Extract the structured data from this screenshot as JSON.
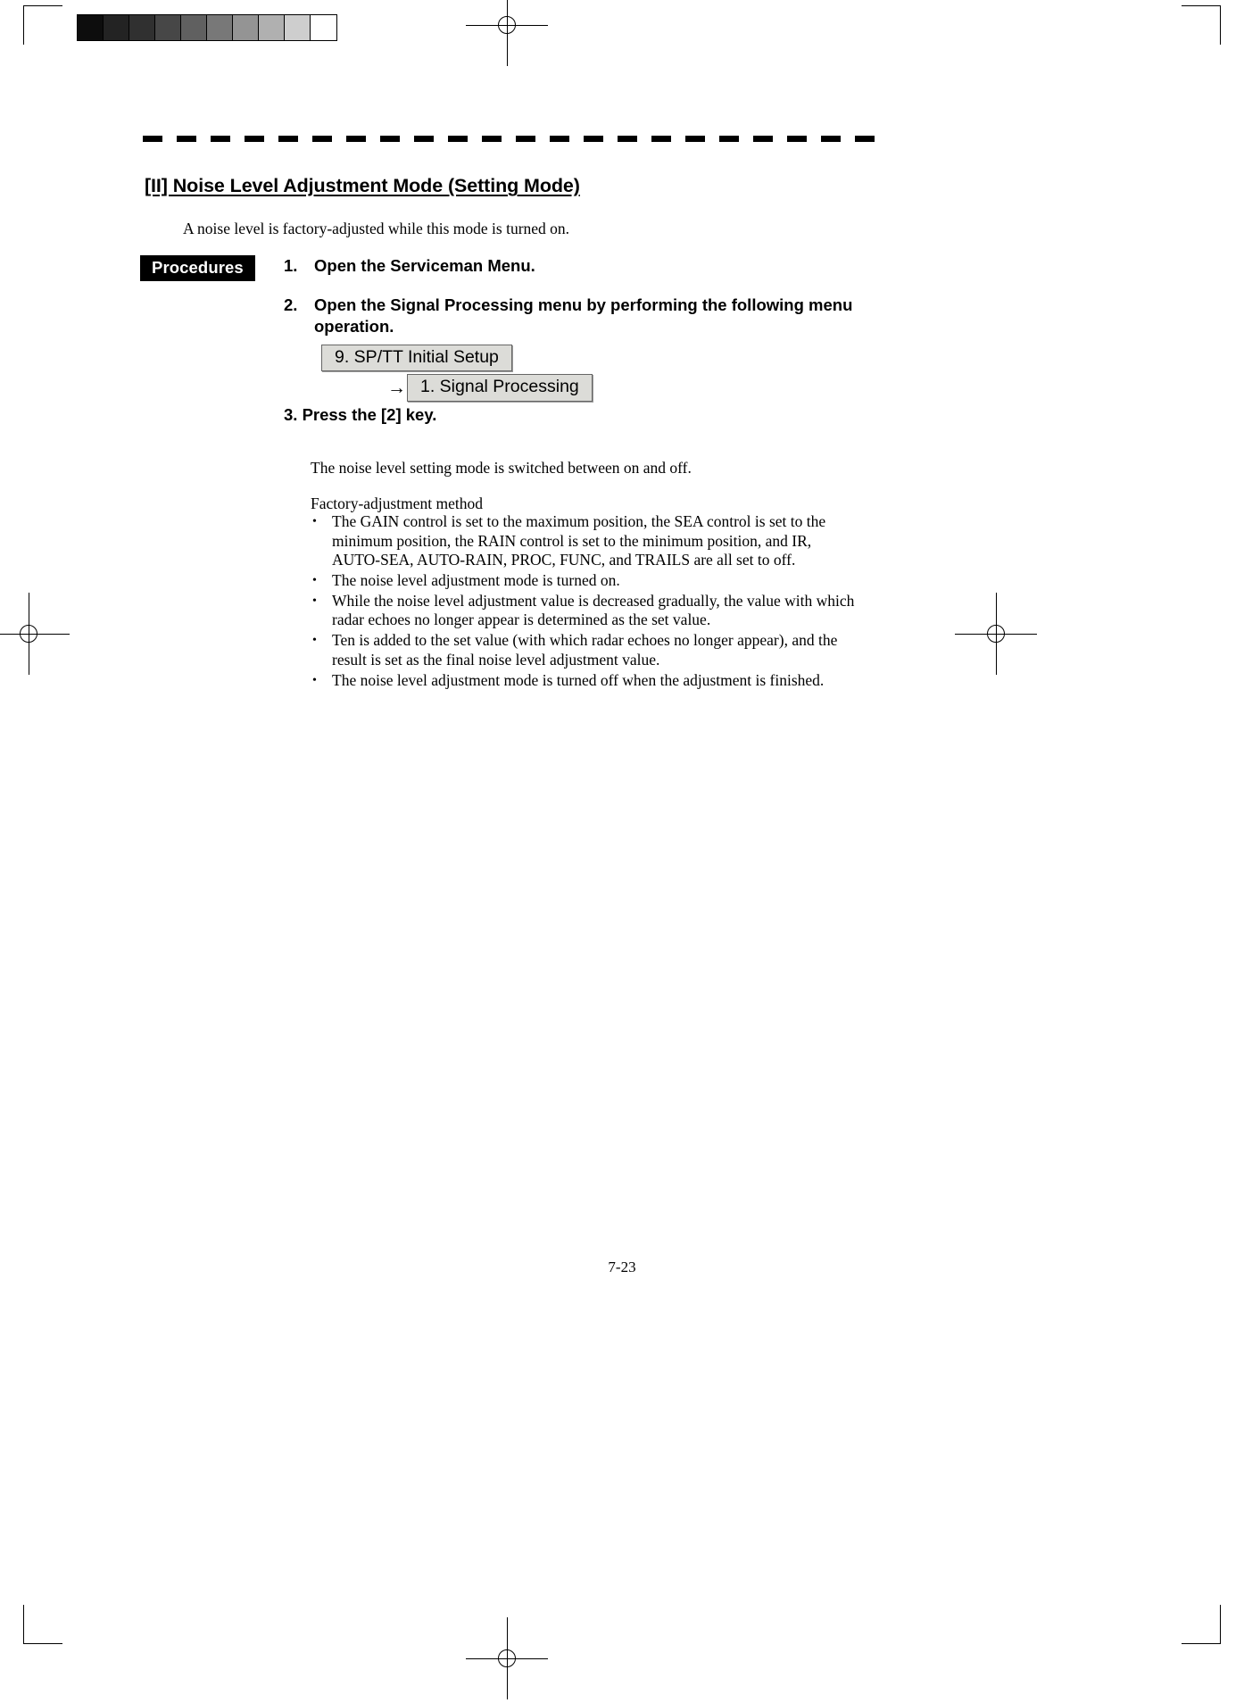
{
  "document": {
    "page_number": "7-23",
    "section_title": "[II] Noise Level Adjustment Mode (Setting Mode)",
    "intro": "A noise level is factory-adjusted while this mode is turned on.",
    "procedures_label": "Procedures"
  },
  "calibration_bar": {
    "name": "grayscale-step-wedge",
    "swatches": [
      "#0d0d0d",
      "#232323",
      "#303030",
      "#474747",
      "#606060",
      "#787878",
      "#949494",
      "#b0b0b0",
      "#cecece",
      "#ffffff"
    ]
  },
  "steps": [
    {
      "num": "1.",
      "text": "Open the Serviceman Menu."
    },
    {
      "num": "2.",
      "text": "Open the Signal Processing menu by performing the following menu operation."
    }
  ],
  "menu_path": {
    "box1": "9. SP/TT Initial Setup",
    "arrow": "→",
    "box2": "1. Signal Processing"
  },
  "step3": {
    "text": "3. Press the [2] key."
  },
  "paragraphs": {
    "switch_note": "The noise level setting mode is switched between on and off.",
    "method_heading": "Factory-adjustment method"
  },
  "bullet_marker": "•",
  "bullets": [
    "The GAIN control is set to the maximum position, the SEA control is set to the minimum position, the RAIN control is set to the minimum position, and IR, AUTO-SEA, AUTO-RAIN, PROC, FUNC, and TRAILS are all set to off.",
    "The noise level adjustment mode is turned on.",
    "While the noise level adjustment value is decreased gradually, the value with which radar echoes no longer appear is determined as the set value.",
    "Ten is added to the set value (with which radar echoes no longer appear), and the result is set as the final noise level adjustment value.",
    "The noise level adjustment mode is turned off when the adjustment is finished."
  ]
}
